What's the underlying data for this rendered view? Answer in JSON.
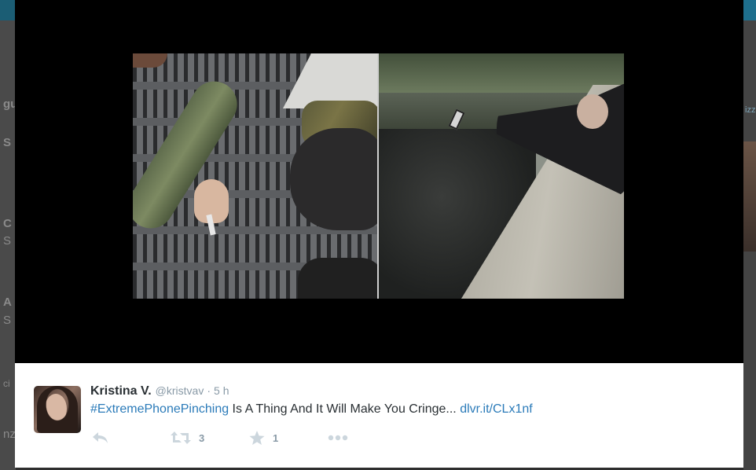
{
  "background_page": {
    "topbar_corner_glyph": "",
    "left_fragments": [
      "gu",
      "S",
      "C",
      "S",
      "A",
      "S",
      "ci",
      "nz"
    ],
    "right_fragments": [
      "izz"
    ]
  },
  "media": {
    "image_description_icon": "photo-collage"
  },
  "tweet": {
    "fullname": "Kristina V.",
    "username": "@kristvav",
    "separator": "·",
    "timestamp": "5 h",
    "hashtag": "#ExtremePhonePinching",
    "text_body": " Is A Thing And It Will Make You Cringe... ",
    "link": "dlvr.it/CLx1nf",
    "retweet_count": "3",
    "favorite_count": "1"
  },
  "colors": {
    "link": "#2b7bb9",
    "icon": "#ccd6dd",
    "text": "#292f33",
    "muted": "#8899a6"
  },
  "icons": {
    "reply": "reply-icon",
    "retweet": "retweet-icon",
    "favorite": "star-icon",
    "more": "more-dots-icon"
  }
}
